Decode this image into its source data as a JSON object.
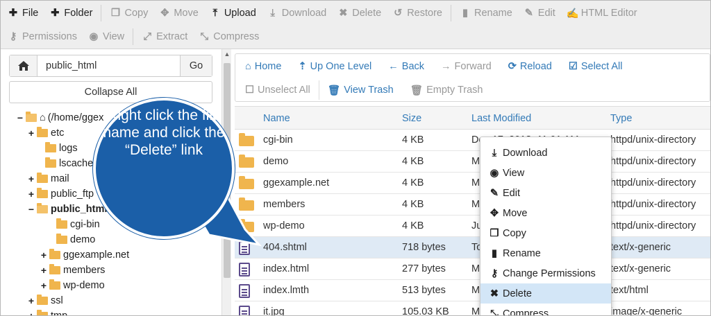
{
  "toolbar": {
    "row1": [
      {
        "label": "File",
        "icon": "plus-icon",
        "active": true
      },
      {
        "label": "Folder",
        "icon": "plus-icon",
        "active": true
      },
      {
        "label": "Copy",
        "icon": "copy-icon",
        "active": false
      },
      {
        "label": "Move",
        "icon": "move-icon",
        "active": false
      },
      {
        "label": "Upload",
        "icon": "upload-icon",
        "active": true
      },
      {
        "label": "Download",
        "icon": "download-icon",
        "active": false
      },
      {
        "label": "Delete",
        "icon": "close-icon",
        "active": false
      },
      {
        "label": "Restore",
        "icon": "restore-icon",
        "active": false
      },
      {
        "label": "Rename",
        "icon": "file-icon",
        "active": false
      },
      {
        "label": "Edit",
        "icon": "pencil-icon",
        "active": false
      },
      {
        "label": "HTML Editor",
        "icon": "html-editor-icon",
        "active": false
      }
    ],
    "row2": [
      {
        "label": "Permissions",
        "icon": "key-icon",
        "active": false
      },
      {
        "label": "View",
        "icon": "eye-icon",
        "active": false
      },
      {
        "label": "Extract",
        "icon": "expand-icon",
        "active": false
      },
      {
        "label": "Compress",
        "icon": "compress-icon",
        "active": false
      }
    ]
  },
  "left": {
    "path_value": "public_html",
    "go_label": "Go",
    "collapse_label": "Collapse All",
    "tree": [
      {
        "label": "(/home/ggex",
        "toggle": "−",
        "home": true,
        "bold": false,
        "open": true
      },
      {
        "label": "etc",
        "toggle": "+",
        "bold": false
      },
      {
        "label": "logs",
        "toggle": "",
        "bold": false
      },
      {
        "label": "lscache",
        "toggle": "",
        "bold": false
      },
      {
        "label": "mail",
        "toggle": "+",
        "bold": false
      },
      {
        "label": "public_ftp",
        "toggle": "+",
        "bold": false
      },
      {
        "label": "public_html",
        "toggle": "−",
        "bold": true,
        "open": true
      },
      {
        "label": "cgi-bin",
        "toggle": "",
        "bold": false
      },
      {
        "label": "demo",
        "toggle": "",
        "bold": false
      },
      {
        "label": "ggexample.net",
        "toggle": "+",
        "bold": false
      },
      {
        "label": "members",
        "toggle": "+",
        "bold": false
      },
      {
        "label": "wp-demo",
        "toggle": "+",
        "bold": false
      },
      {
        "label": "ssl",
        "toggle": "+",
        "bold": false
      },
      {
        "label": "tmp",
        "toggle": "+",
        "bold": false
      }
    ]
  },
  "nav": {
    "row1": [
      {
        "label": "Home",
        "icon": "home-icon",
        "active": true
      },
      {
        "label": "Up One Level",
        "icon": "level-up-icon",
        "active": true
      },
      {
        "label": "Back",
        "icon": "arrow-left-icon",
        "active": true
      },
      {
        "label": "Forward",
        "icon": "arrow-right-icon",
        "active": false
      },
      {
        "label": "Reload",
        "icon": "refresh-icon",
        "active": true
      },
      {
        "label": "Select All",
        "icon": "checkbox-icon",
        "active": true
      }
    ],
    "row2": [
      {
        "label": "Unselect All",
        "icon": "empty-checkbox-icon",
        "active": false
      },
      {
        "label": "View Trash",
        "icon": "trash-icon",
        "active": true
      },
      {
        "label": "Empty Trash",
        "icon": "trash-icon",
        "active": false
      }
    ]
  },
  "table": {
    "headers": {
      "name": "Name",
      "size": "Size",
      "modified": "Last Modified",
      "type": "Type"
    },
    "rows": [
      {
        "name": "cgi-bin",
        "size": "4 KB",
        "modified": "Dec 17, 2018, 11:01 AM",
        "type": "httpd/unix-directory",
        "kind": "folder"
      },
      {
        "name": "demo",
        "size": "4 KB",
        "modified": "M",
        "type": "httpd/unix-directory",
        "kind": "folder"
      },
      {
        "name": "ggexample.net",
        "size": "4 KB",
        "modified": "M",
        "type": "httpd/unix-directory",
        "kind": "folder"
      },
      {
        "name": "members",
        "size": "4 KB",
        "modified": "M",
        "type": "httpd/unix-directory",
        "kind": "folder"
      },
      {
        "name": "wp-demo",
        "size": "4 KB",
        "modified": "Ju",
        "type": "httpd/unix-directory",
        "kind": "folder"
      },
      {
        "name": "404.shtml",
        "size": "718 bytes",
        "modified": "To",
        "type": "text/x-generic",
        "kind": "doc",
        "selected": true
      },
      {
        "name": "index.html",
        "size": "277 bytes",
        "modified": "M",
        "type": "text/x-generic",
        "kind": "doc"
      },
      {
        "name": "index.lmth",
        "size": "513 bytes",
        "modified": "M",
        "type": "text/html",
        "kind": "code"
      },
      {
        "name": "it.jpg",
        "size": "105.03 KB",
        "modified": "M",
        "type": "image/x-generic",
        "kind": "image"
      }
    ]
  },
  "context_menu": [
    {
      "label": "Download",
      "icon": "download-icon"
    },
    {
      "label": "View",
      "icon": "eye-icon"
    },
    {
      "label": "Edit",
      "icon": "pencil-icon"
    },
    {
      "label": "Move",
      "icon": "move-icon"
    },
    {
      "label": "Copy",
      "icon": "copy-icon"
    },
    {
      "label": "Rename",
      "icon": "file-icon"
    },
    {
      "label": "Change Permissions",
      "icon": "key-icon"
    },
    {
      "label": "Delete",
      "icon": "close-icon",
      "highlighted": true
    },
    {
      "label": "Compress",
      "icon": "compress-icon"
    }
  ],
  "callout": {
    "text": "Right click the file name and click the “Delete” link",
    "color": "#1b5fa8"
  }
}
